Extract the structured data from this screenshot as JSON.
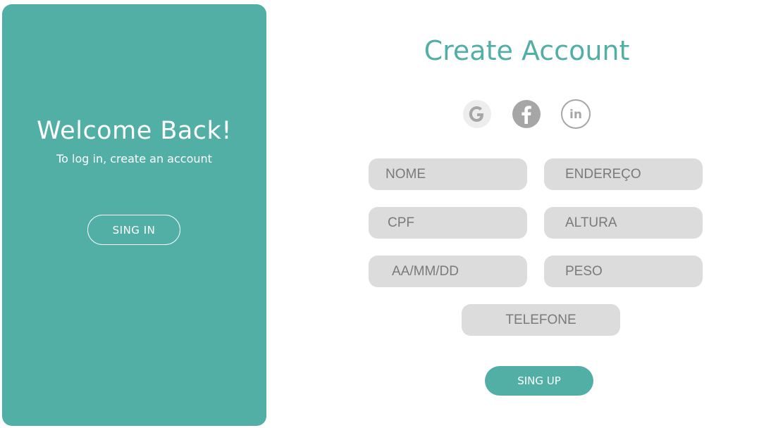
{
  "left_panel": {
    "title": "Welcome Back!",
    "subtitle": "To log in, create an account",
    "signin_label": "SING IN"
  },
  "form": {
    "title": "Create Account",
    "social_icons": [
      "google-icon",
      "facebook-icon",
      "linkedin-icon"
    ],
    "fields": {
      "nome": "NOME",
      "endereco": "ENDEREÇO",
      "cpf": "CPF",
      "altura": "ALTURA",
      "data_nascimento": "AA/MM/DD",
      "peso": "PESO",
      "telefone": "TELEFONE"
    },
    "signup_label": "SING UP"
  },
  "colors": {
    "accent": "#52afa5",
    "field_bg": "#dcdcdc",
    "field_text": "#7a7a7a",
    "icon_gray": "#a6a6a6"
  }
}
